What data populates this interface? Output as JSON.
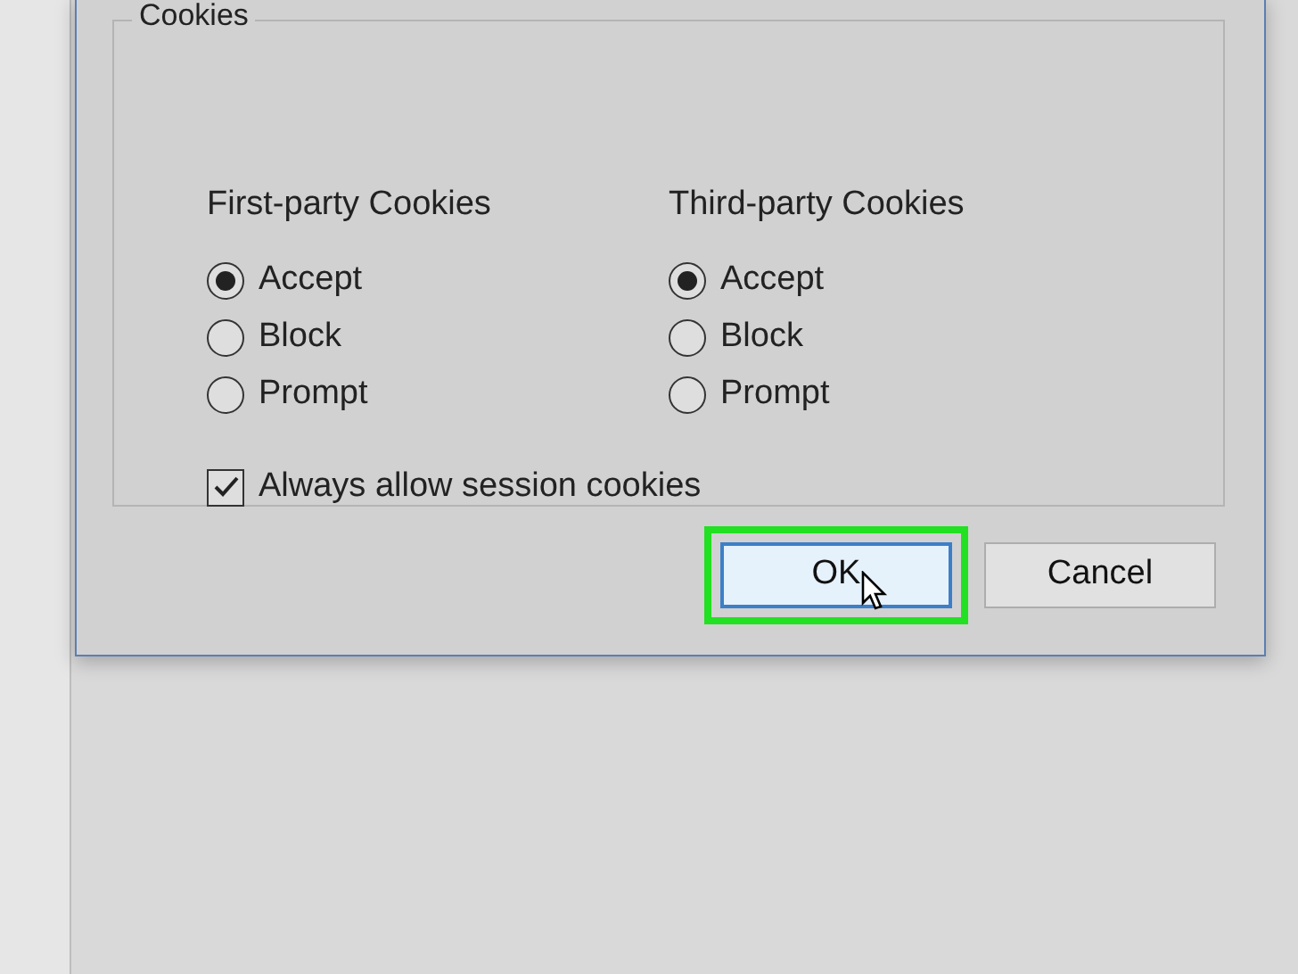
{
  "group": {
    "title": "Cookies"
  },
  "columns": [
    {
      "heading": "First-party Cookies",
      "options": [
        {
          "label": "Accept",
          "selected": true
        },
        {
          "label": "Block",
          "selected": false
        },
        {
          "label": "Prompt",
          "selected": false
        }
      ]
    },
    {
      "heading": "Third-party Cookies",
      "options": [
        {
          "label": "Accept",
          "selected": true
        },
        {
          "label": "Block",
          "selected": false
        },
        {
          "label": "Prompt",
          "selected": false
        }
      ]
    }
  ],
  "checkbox": {
    "label": "Always allow session cookies",
    "checked": true
  },
  "buttons": [
    {
      "label": "OK",
      "default": true,
      "highlighted": true
    },
    {
      "label": "Cancel",
      "default": false,
      "highlighted": false
    }
  ]
}
